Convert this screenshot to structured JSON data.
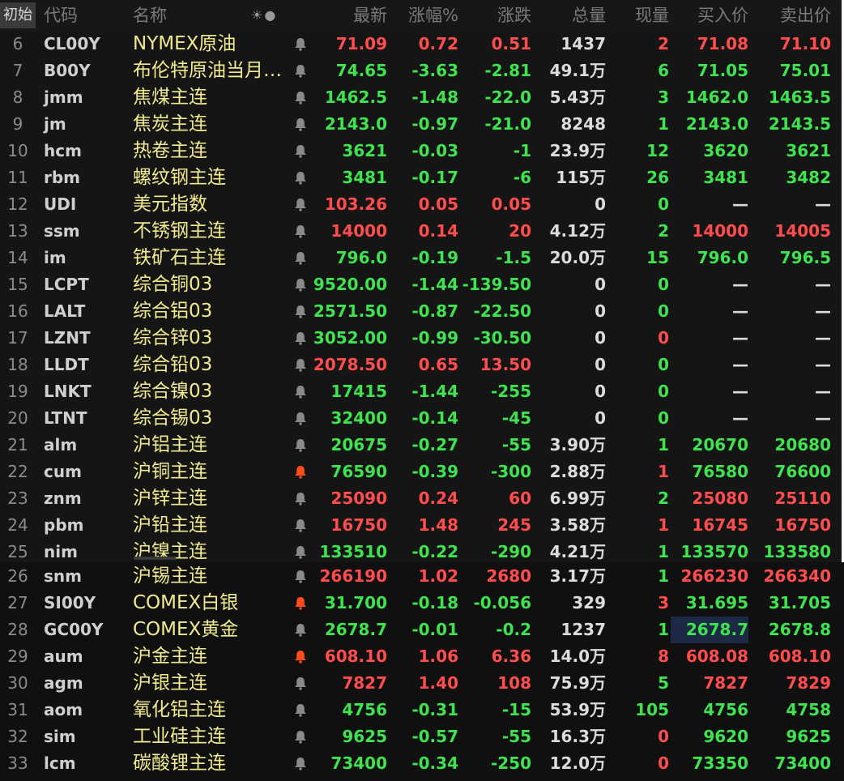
{
  "corner_label": "初始",
  "header": {
    "code": "代码",
    "name": "名称",
    "icons": "☀●",
    "price": "最新",
    "pct": "涨幅%",
    "chg": "涨跌",
    "vol": "总量",
    "cur": "现量",
    "bid": "买入价",
    "ask": "卖出价"
  },
  "colors": {
    "up": "#ff4d4d",
    "down": "#3fe24f",
    "name": "#f2eb8e",
    "bell_active": "#ff4d1a",
    "bell_idle": "#8a8a8a"
  },
  "rows": [
    {
      "num": "6",
      "code": "CL00Y",
      "name": "NYMEX原油",
      "alert": false,
      "price": "71.09",
      "pct": "0.72",
      "chg": "0.51",
      "vol": "1437",
      "cur": "2",
      "bid": "71.08",
      "ask": "71.10",
      "c": {
        "price": "red",
        "pct": "red",
        "chg": "red",
        "cur": "red",
        "bid": "red",
        "ask": "red"
      }
    },
    {
      "num": "7",
      "code": "B00Y",
      "name": "布伦特原油当月…",
      "alert": false,
      "price": "74.65",
      "pct": "-3.63",
      "chg": "-2.81",
      "vol": "49.1万",
      "cur": "6",
      "bid": "71.05",
      "ask": "75.01",
      "c": {
        "price": "green",
        "pct": "green",
        "chg": "green",
        "cur": "green",
        "bid": "green",
        "ask": "green"
      }
    },
    {
      "num": "8",
      "code": "jmm",
      "name": "焦煤主连",
      "alert": false,
      "price": "1462.5",
      "pct": "-1.48",
      "chg": "-22.0",
      "vol": "5.43万",
      "cur": "3",
      "bid": "1462.0",
      "ask": "1463.5",
      "c": {
        "price": "green",
        "pct": "green",
        "chg": "green",
        "cur": "green",
        "bid": "green",
        "ask": "green"
      }
    },
    {
      "num": "9",
      "code": "jm",
      "name": "焦炭主连",
      "alert": false,
      "price": "2143.0",
      "pct": "-0.97",
      "chg": "-21.0",
      "vol": "8248",
      "cur": "1",
      "bid": "2143.0",
      "ask": "2143.5",
      "c": {
        "price": "green",
        "pct": "green",
        "chg": "green",
        "cur": "green",
        "bid": "green",
        "ask": "green"
      }
    },
    {
      "num": "10",
      "code": "hcm",
      "name": "热卷主连",
      "alert": false,
      "price": "3621",
      "pct": "-0.03",
      "chg": "-1",
      "vol": "23.9万",
      "cur": "12",
      "bid": "3620",
      "ask": "3621",
      "c": {
        "price": "green",
        "pct": "green",
        "chg": "green",
        "cur": "green",
        "bid": "green",
        "ask": "green"
      }
    },
    {
      "num": "11",
      "code": "rbm",
      "name": "螺纹钢主连",
      "alert": false,
      "price": "3481",
      "pct": "-0.17",
      "chg": "-6",
      "vol": "115万",
      "cur": "26",
      "bid": "3481",
      "ask": "3482",
      "c": {
        "price": "green",
        "pct": "green",
        "chg": "green",
        "cur": "green",
        "bid": "green",
        "ask": "green"
      }
    },
    {
      "num": "12",
      "code": "UDI",
      "name": "美元指数",
      "alert": false,
      "price": "103.26",
      "pct": "0.05",
      "chg": "0.05",
      "vol": "0",
      "cur": "0",
      "bid": "—",
      "ask": "—",
      "c": {
        "price": "red",
        "pct": "red",
        "chg": "red",
        "cur": "green",
        "bid": "white",
        "ask": "white"
      }
    },
    {
      "num": "13",
      "code": "ssm",
      "name": "不锈钢主连",
      "alert": false,
      "price": "14000",
      "pct": "0.14",
      "chg": "20",
      "vol": "4.12万",
      "cur": "2",
      "bid": "14000",
      "ask": "14005",
      "c": {
        "price": "red",
        "pct": "red",
        "chg": "red",
        "cur": "green",
        "bid": "red",
        "ask": "red"
      }
    },
    {
      "num": "14",
      "code": "im",
      "name": "铁矿石主连",
      "alert": false,
      "price": "796.0",
      "pct": "-0.19",
      "chg": "-1.5",
      "vol": "20.0万",
      "cur": "15",
      "bid": "796.0",
      "ask": "796.5",
      "c": {
        "price": "green",
        "pct": "green",
        "chg": "green",
        "cur": "green",
        "bid": "green",
        "ask": "green"
      }
    },
    {
      "num": "15",
      "code": "LCPT",
      "name": "综合铜03",
      "alert": false,
      "price": "9520.00",
      "pct": "-1.44",
      "chg": "-139.50",
      "vol": "0",
      "cur": "0",
      "bid": "—",
      "ask": "—",
      "c": {
        "price": "green",
        "pct": "green",
        "chg": "green",
        "cur": "green",
        "bid": "white",
        "ask": "white"
      }
    },
    {
      "num": "16",
      "code": "LALT",
      "name": "综合铝03",
      "alert": false,
      "price": "2571.50",
      "pct": "-0.87",
      "chg": "-22.50",
      "vol": "0",
      "cur": "0",
      "bid": "—",
      "ask": "—",
      "c": {
        "price": "green",
        "pct": "green",
        "chg": "green",
        "cur": "green",
        "bid": "white",
        "ask": "white"
      }
    },
    {
      "num": "17",
      "code": "LZNT",
      "name": "综合锌03",
      "alert": false,
      "price": "3052.00",
      "pct": "-0.99",
      "chg": "-30.50",
      "vol": "0",
      "cur": "0",
      "bid": "—",
      "ask": "—",
      "c": {
        "price": "green",
        "pct": "green",
        "chg": "green",
        "cur": "red",
        "bid": "white",
        "ask": "white"
      }
    },
    {
      "num": "18",
      "code": "LLDT",
      "name": "综合铅03",
      "alert": false,
      "price": "2078.50",
      "pct": "0.65",
      "chg": "13.50",
      "vol": "0",
      "cur": "0",
      "bid": "—",
      "ask": "—",
      "c": {
        "price": "red",
        "pct": "red",
        "chg": "red",
        "cur": "green",
        "bid": "white",
        "ask": "white"
      }
    },
    {
      "num": "19",
      "code": "LNKT",
      "name": "综合镍03",
      "alert": false,
      "price": "17415",
      "pct": "-1.44",
      "chg": "-255",
      "vol": "0",
      "cur": "0",
      "bid": "—",
      "ask": "—",
      "c": {
        "price": "green",
        "pct": "green",
        "chg": "green",
        "cur": "green",
        "bid": "white",
        "ask": "white"
      }
    },
    {
      "num": "20",
      "code": "LTNT",
      "name": "综合锡03",
      "alert": false,
      "price": "32400",
      "pct": "-0.14",
      "chg": "-45",
      "vol": "0",
      "cur": "0",
      "bid": "—",
      "ask": "—",
      "c": {
        "price": "green",
        "pct": "green",
        "chg": "green",
        "cur": "green",
        "bid": "white",
        "ask": "white"
      }
    },
    {
      "num": "21",
      "code": "alm",
      "name": "沪铝主连",
      "alert": false,
      "price": "20675",
      "pct": "-0.27",
      "chg": "-55",
      "vol": "3.90万",
      "cur": "1",
      "bid": "20670",
      "ask": "20680",
      "c": {
        "price": "green",
        "pct": "green",
        "chg": "green",
        "cur": "green",
        "bid": "green",
        "ask": "green"
      }
    },
    {
      "num": "22",
      "code": "cum",
      "name": "沪铜主连",
      "alert": true,
      "price": "76590",
      "pct": "-0.39",
      "chg": "-300",
      "vol": "2.88万",
      "cur": "1",
      "bid": "76580",
      "ask": "76600",
      "c": {
        "price": "green",
        "pct": "green",
        "chg": "green",
        "cur": "red",
        "bid": "green",
        "ask": "green"
      }
    },
    {
      "num": "23",
      "code": "znm",
      "name": "沪锌主连",
      "alert": false,
      "price": "25090",
      "pct": "0.24",
      "chg": "60",
      "vol": "6.99万",
      "cur": "2",
      "bid": "25080",
      "ask": "25110",
      "c": {
        "price": "red",
        "pct": "red",
        "chg": "red",
        "cur": "green",
        "bid": "red",
        "ask": "red"
      }
    },
    {
      "num": "24",
      "code": "pbm",
      "name": "沪铅主连",
      "alert": false,
      "price": "16750",
      "pct": "1.48",
      "chg": "245",
      "vol": "3.58万",
      "cur": "1",
      "bid": "16745",
      "ask": "16750",
      "c": {
        "price": "red",
        "pct": "red",
        "chg": "red",
        "cur": "red",
        "bid": "red",
        "ask": "red"
      }
    },
    {
      "num": "25",
      "code": "nim",
      "name": "沪镍主连",
      "alert": false,
      "price": "133510",
      "pct": "-0.22",
      "chg": "-290",
      "vol": "4.21万",
      "cur": "1",
      "bid": "133570",
      "ask": "133580",
      "c": {
        "price": "green",
        "pct": "green",
        "chg": "green",
        "cur": "green",
        "bid": "green",
        "ask": "green"
      }
    },
    {
      "num": "26",
      "code": "snm",
      "name": "沪锡主连",
      "alert": false,
      "price": "266190",
      "pct": "1.02",
      "chg": "2680",
      "vol": "3.17万",
      "cur": "1",
      "bid": "266230",
      "ask": "266340",
      "c": {
        "price": "red",
        "pct": "red",
        "chg": "red",
        "cur": "green",
        "bid": "red",
        "ask": "red"
      }
    },
    {
      "num": "27",
      "code": "SI00Y",
      "name": "COMEX白银",
      "alert": true,
      "price": "31.700",
      "pct": "-0.18",
      "chg": "-0.056",
      "vol": "329",
      "cur": "3",
      "bid": "31.695",
      "ask": "31.705",
      "c": {
        "price": "green",
        "pct": "green",
        "chg": "green",
        "cur": "red",
        "bid": "green",
        "ask": "green"
      }
    },
    {
      "num": "28",
      "code": "GC00Y",
      "name": "COMEX黄金",
      "alert": false,
      "price": "2678.7",
      "pct": "-0.01",
      "chg": "-0.2",
      "vol": "1237",
      "cur": "1",
      "bid": "2678.7",
      "ask": "2678.8",
      "selected_bid": true,
      "c": {
        "price": "green",
        "pct": "green",
        "chg": "green",
        "cur": "green",
        "bid": "green",
        "ask": "green"
      }
    },
    {
      "num": "29",
      "code": "aum",
      "name": "沪金主连",
      "alert": true,
      "price": "608.10",
      "pct": "1.06",
      "chg": "6.36",
      "vol": "14.0万",
      "cur": "8",
      "bid": "608.08",
      "ask": "608.10",
      "c": {
        "price": "red",
        "pct": "red",
        "chg": "red",
        "cur": "red",
        "bid": "red",
        "ask": "red"
      }
    },
    {
      "num": "30",
      "code": "agm",
      "name": "沪银主连",
      "alert": false,
      "price": "7827",
      "pct": "1.40",
      "chg": "108",
      "vol": "75.9万",
      "cur": "5",
      "bid": "7827",
      "ask": "7829",
      "c": {
        "price": "red",
        "pct": "red",
        "chg": "red",
        "cur": "green",
        "bid": "red",
        "ask": "red"
      }
    },
    {
      "num": "31",
      "code": "aom",
      "name": "氧化铝主连",
      "alert": false,
      "price": "4756",
      "pct": "-0.31",
      "chg": "-15",
      "vol": "53.9万",
      "cur": "105",
      "bid": "4756",
      "ask": "4758",
      "c": {
        "price": "green",
        "pct": "green",
        "chg": "green",
        "cur": "green",
        "bid": "green",
        "ask": "green"
      }
    },
    {
      "num": "32",
      "code": "sim",
      "name": "工业硅主连",
      "alert": false,
      "price": "9625",
      "pct": "-0.57",
      "chg": "-55",
      "vol": "16.3万",
      "cur": "0",
      "bid": "9620",
      "ask": "9625",
      "c": {
        "price": "green",
        "pct": "green",
        "chg": "green",
        "cur": "red",
        "bid": "green",
        "ask": "green"
      }
    },
    {
      "num": "33",
      "code": "lcm",
      "name": "碳酸锂主连",
      "alert": false,
      "price": "73400",
      "pct": "-0.34",
      "chg": "-250",
      "vol": "12.0万",
      "cur": "0",
      "bid": "73350",
      "ask": "73400",
      "c": {
        "price": "green",
        "pct": "green",
        "chg": "green",
        "cur": "red",
        "bid": "green",
        "ask": "green"
      }
    }
  ]
}
